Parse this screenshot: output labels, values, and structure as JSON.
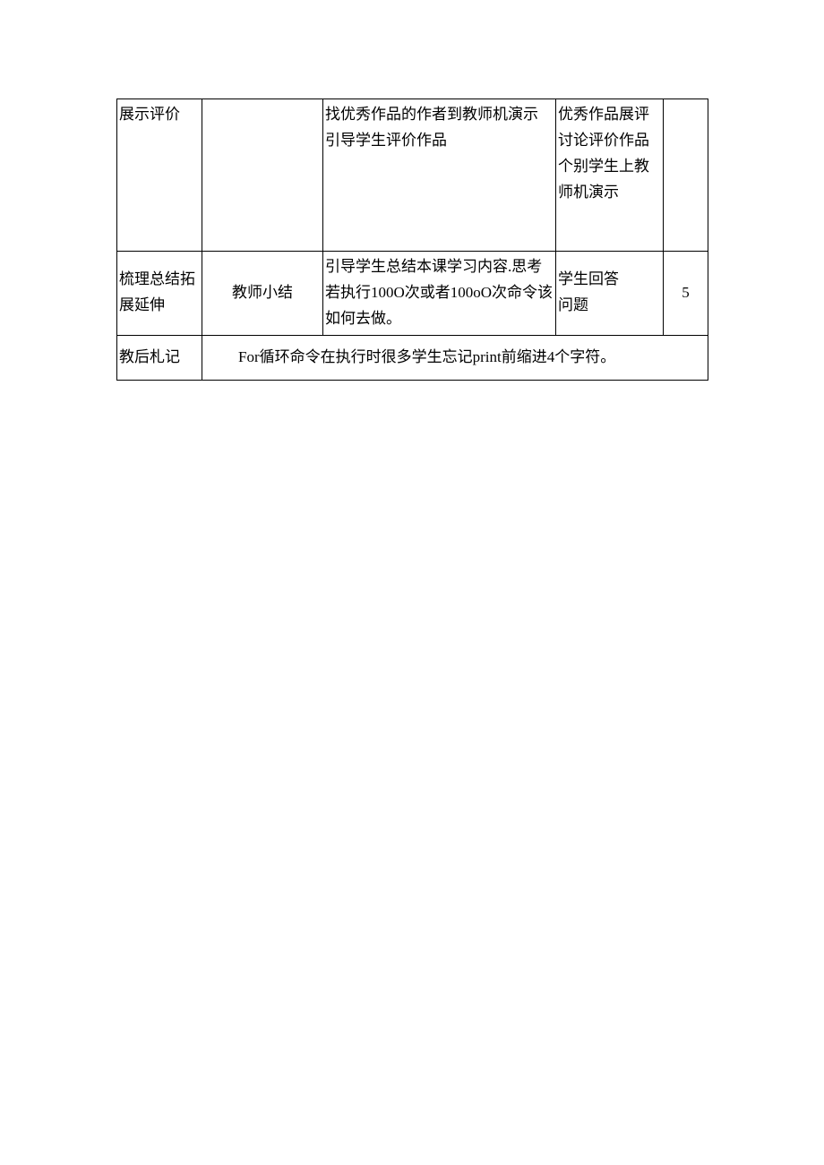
{
  "table": {
    "rows": [
      {
        "col1": "展示评价",
        "col2": "",
        "col3": "找优秀作品的作者到教师机演示\n引导学生评价作品",
        "col4": "优秀作品展评讨论评价作品个别学生上教师机演示",
        "col5": ""
      },
      {
        "col1": "梳理总结拓展延伸",
        "col2": "教师小结",
        "col3": "引导学生总结本课学习内容.思考若执行100O次或者100oO次命令该如何去做。",
        "col4": "学生回答\n问题",
        "col5": "5"
      },
      {
        "col1": "教后札记",
        "merged": "For循环命令在执行时很多学生忘记print前缩进4个字符。"
      }
    ]
  }
}
